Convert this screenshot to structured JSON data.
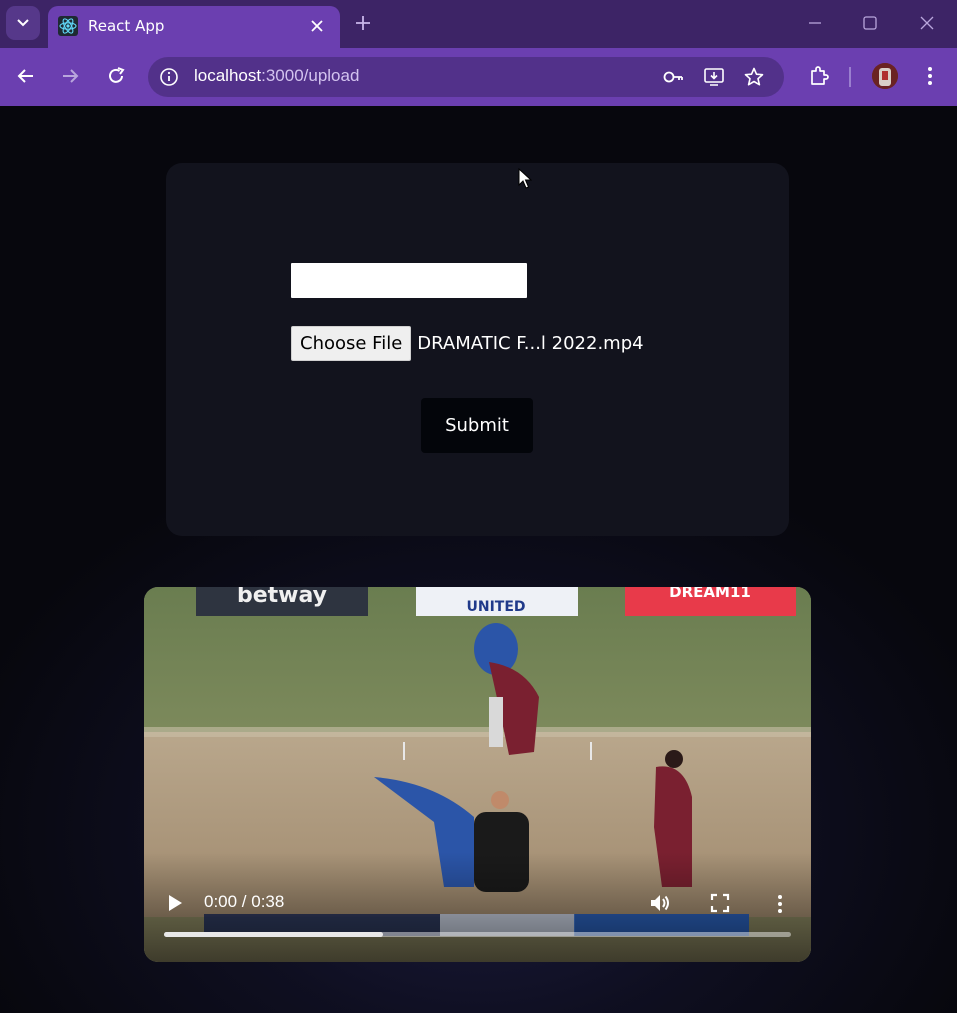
{
  "browser": {
    "tab": {
      "title": "React App"
    },
    "address": {
      "host": "localhost",
      "path": ":3000/upload"
    }
  },
  "form": {
    "text_input": {
      "value": ""
    },
    "file": {
      "choose_label": "Choose File",
      "file_name": "DRAMATIC F...l 2022.mp4"
    },
    "submit_label": "Submit"
  },
  "video": {
    "time": "0:00 / 0:38",
    "buffered_fraction": 0.35
  },
  "colors": {
    "tabbar": "#3d2466",
    "toolbar": "#6b3fb0",
    "card": "#12131d",
    "page_bg": "#07070d"
  }
}
